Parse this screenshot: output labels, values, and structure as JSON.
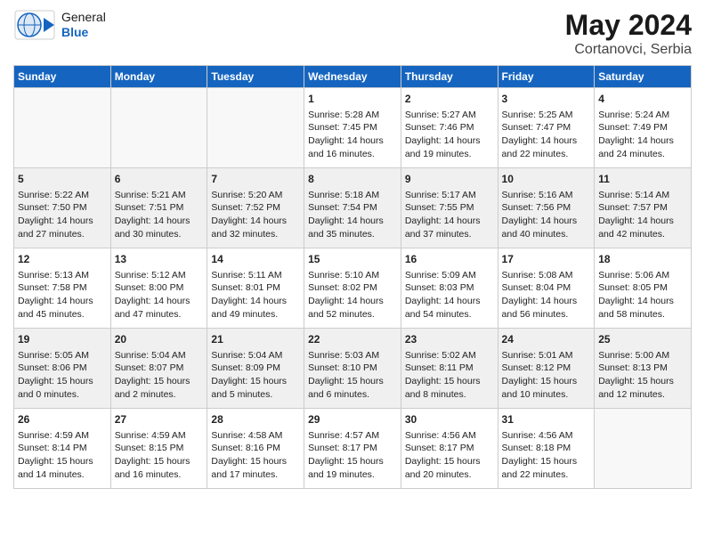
{
  "header": {
    "logo_general": "General",
    "logo_blue": "Blue",
    "month_year": "May 2024",
    "location": "Cortanovci, Serbia"
  },
  "days_of_week": [
    "Sunday",
    "Monday",
    "Tuesday",
    "Wednesday",
    "Thursday",
    "Friday",
    "Saturday"
  ],
  "weeks": [
    [
      {
        "day": "",
        "info": ""
      },
      {
        "day": "",
        "info": ""
      },
      {
        "day": "",
        "info": ""
      },
      {
        "day": "1",
        "info": "Sunrise: 5:28 AM\nSunset: 7:45 PM\nDaylight: 14 hours\nand 16 minutes."
      },
      {
        "day": "2",
        "info": "Sunrise: 5:27 AM\nSunset: 7:46 PM\nDaylight: 14 hours\nand 19 minutes."
      },
      {
        "day": "3",
        "info": "Sunrise: 5:25 AM\nSunset: 7:47 PM\nDaylight: 14 hours\nand 22 minutes."
      },
      {
        "day": "4",
        "info": "Sunrise: 5:24 AM\nSunset: 7:49 PM\nDaylight: 14 hours\nand 24 minutes."
      }
    ],
    [
      {
        "day": "5",
        "info": "Sunrise: 5:22 AM\nSunset: 7:50 PM\nDaylight: 14 hours\nand 27 minutes."
      },
      {
        "day": "6",
        "info": "Sunrise: 5:21 AM\nSunset: 7:51 PM\nDaylight: 14 hours\nand 30 minutes."
      },
      {
        "day": "7",
        "info": "Sunrise: 5:20 AM\nSunset: 7:52 PM\nDaylight: 14 hours\nand 32 minutes."
      },
      {
        "day": "8",
        "info": "Sunrise: 5:18 AM\nSunset: 7:54 PM\nDaylight: 14 hours\nand 35 minutes."
      },
      {
        "day": "9",
        "info": "Sunrise: 5:17 AM\nSunset: 7:55 PM\nDaylight: 14 hours\nand 37 minutes."
      },
      {
        "day": "10",
        "info": "Sunrise: 5:16 AM\nSunset: 7:56 PM\nDaylight: 14 hours\nand 40 minutes."
      },
      {
        "day": "11",
        "info": "Sunrise: 5:14 AM\nSunset: 7:57 PM\nDaylight: 14 hours\nand 42 minutes."
      }
    ],
    [
      {
        "day": "12",
        "info": "Sunrise: 5:13 AM\nSunset: 7:58 PM\nDaylight: 14 hours\nand 45 minutes."
      },
      {
        "day": "13",
        "info": "Sunrise: 5:12 AM\nSunset: 8:00 PM\nDaylight: 14 hours\nand 47 minutes."
      },
      {
        "day": "14",
        "info": "Sunrise: 5:11 AM\nSunset: 8:01 PM\nDaylight: 14 hours\nand 49 minutes."
      },
      {
        "day": "15",
        "info": "Sunrise: 5:10 AM\nSunset: 8:02 PM\nDaylight: 14 hours\nand 52 minutes."
      },
      {
        "day": "16",
        "info": "Sunrise: 5:09 AM\nSunset: 8:03 PM\nDaylight: 14 hours\nand 54 minutes."
      },
      {
        "day": "17",
        "info": "Sunrise: 5:08 AM\nSunset: 8:04 PM\nDaylight: 14 hours\nand 56 minutes."
      },
      {
        "day": "18",
        "info": "Sunrise: 5:06 AM\nSunset: 8:05 PM\nDaylight: 14 hours\nand 58 minutes."
      }
    ],
    [
      {
        "day": "19",
        "info": "Sunrise: 5:05 AM\nSunset: 8:06 PM\nDaylight: 15 hours\nand 0 minutes."
      },
      {
        "day": "20",
        "info": "Sunrise: 5:04 AM\nSunset: 8:07 PM\nDaylight: 15 hours\nand 2 minutes."
      },
      {
        "day": "21",
        "info": "Sunrise: 5:04 AM\nSunset: 8:09 PM\nDaylight: 15 hours\nand 5 minutes."
      },
      {
        "day": "22",
        "info": "Sunrise: 5:03 AM\nSunset: 8:10 PM\nDaylight: 15 hours\nand 6 minutes."
      },
      {
        "day": "23",
        "info": "Sunrise: 5:02 AM\nSunset: 8:11 PM\nDaylight: 15 hours\nand 8 minutes."
      },
      {
        "day": "24",
        "info": "Sunrise: 5:01 AM\nSunset: 8:12 PM\nDaylight: 15 hours\nand 10 minutes."
      },
      {
        "day": "25",
        "info": "Sunrise: 5:00 AM\nSunset: 8:13 PM\nDaylight: 15 hours\nand 12 minutes."
      }
    ],
    [
      {
        "day": "26",
        "info": "Sunrise: 4:59 AM\nSunset: 8:14 PM\nDaylight: 15 hours\nand 14 minutes."
      },
      {
        "day": "27",
        "info": "Sunrise: 4:59 AM\nSunset: 8:15 PM\nDaylight: 15 hours\nand 16 minutes."
      },
      {
        "day": "28",
        "info": "Sunrise: 4:58 AM\nSunset: 8:16 PM\nDaylight: 15 hours\nand 17 minutes."
      },
      {
        "day": "29",
        "info": "Sunrise: 4:57 AM\nSunset: 8:17 PM\nDaylight: 15 hours\nand 19 minutes."
      },
      {
        "day": "30",
        "info": "Sunrise: 4:56 AM\nSunset: 8:17 PM\nDaylight: 15 hours\nand 20 minutes."
      },
      {
        "day": "31",
        "info": "Sunrise: 4:56 AM\nSunset: 8:18 PM\nDaylight: 15 hours\nand 22 minutes."
      },
      {
        "day": "",
        "info": ""
      }
    ]
  ]
}
